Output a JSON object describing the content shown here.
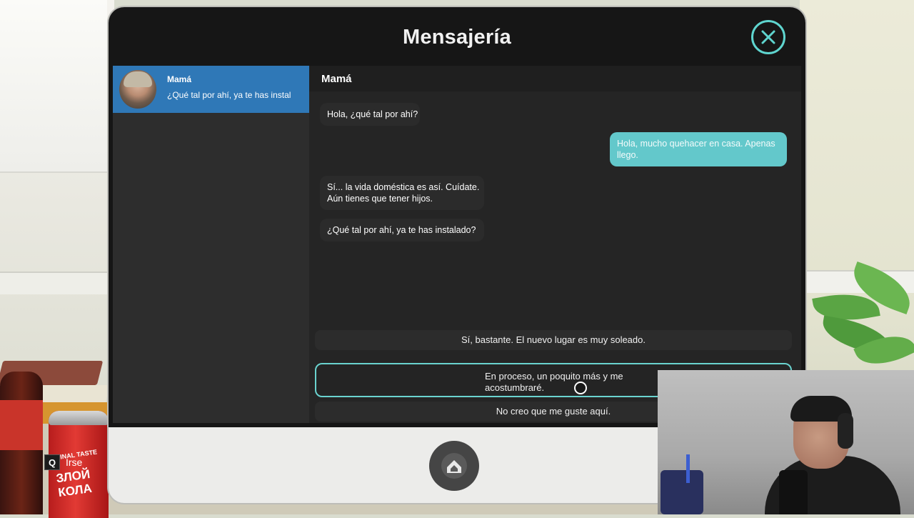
{
  "app": {
    "title": "Mensajería",
    "close_label": "close"
  },
  "sidebar": {
    "contacts": [
      {
        "name": "Mamá",
        "preview": "¿Qué tal por ahí, ya te has instal"
      }
    ]
  },
  "chat": {
    "header": "Mamá",
    "messages": [
      {
        "from": "Mamá",
        "text": "Hola, ¿qué tal por ahí?"
      },
      {
        "from": "me",
        "text": "Hola, mucho quehacer en casa. Apenas llego."
      },
      {
        "from": "Mamá",
        "text": "Sí... la vida doméstica es así. Cuídate.\nAún tienes que tener hijos."
      },
      {
        "from": "Mamá",
        "text": "¿Qué tal por ahí, ya te has instalado?"
      }
    ]
  },
  "choices": [
    {
      "text": "Sí, bastante. El nuevo lugar es muy soleado.",
      "selected": false
    },
    {
      "text": "En proceso, un poquito más y me\nacostumbraré.",
      "selected": true
    },
    {
      "text": "No creo que me guste aquí.",
      "selected": false
    }
  ],
  "hint": {
    "key": "Q",
    "label": "Irse"
  },
  "props": {
    "can_text": "ЗЛОЙ\nКОЛА",
    "can_small": "INAL TASTE"
  },
  "colors": {
    "accent": "#5fd5cf",
    "selected_contact": "#2f78b7",
    "outgoing_bubble": "#63c8cb",
    "screen_bg": "#161616"
  }
}
